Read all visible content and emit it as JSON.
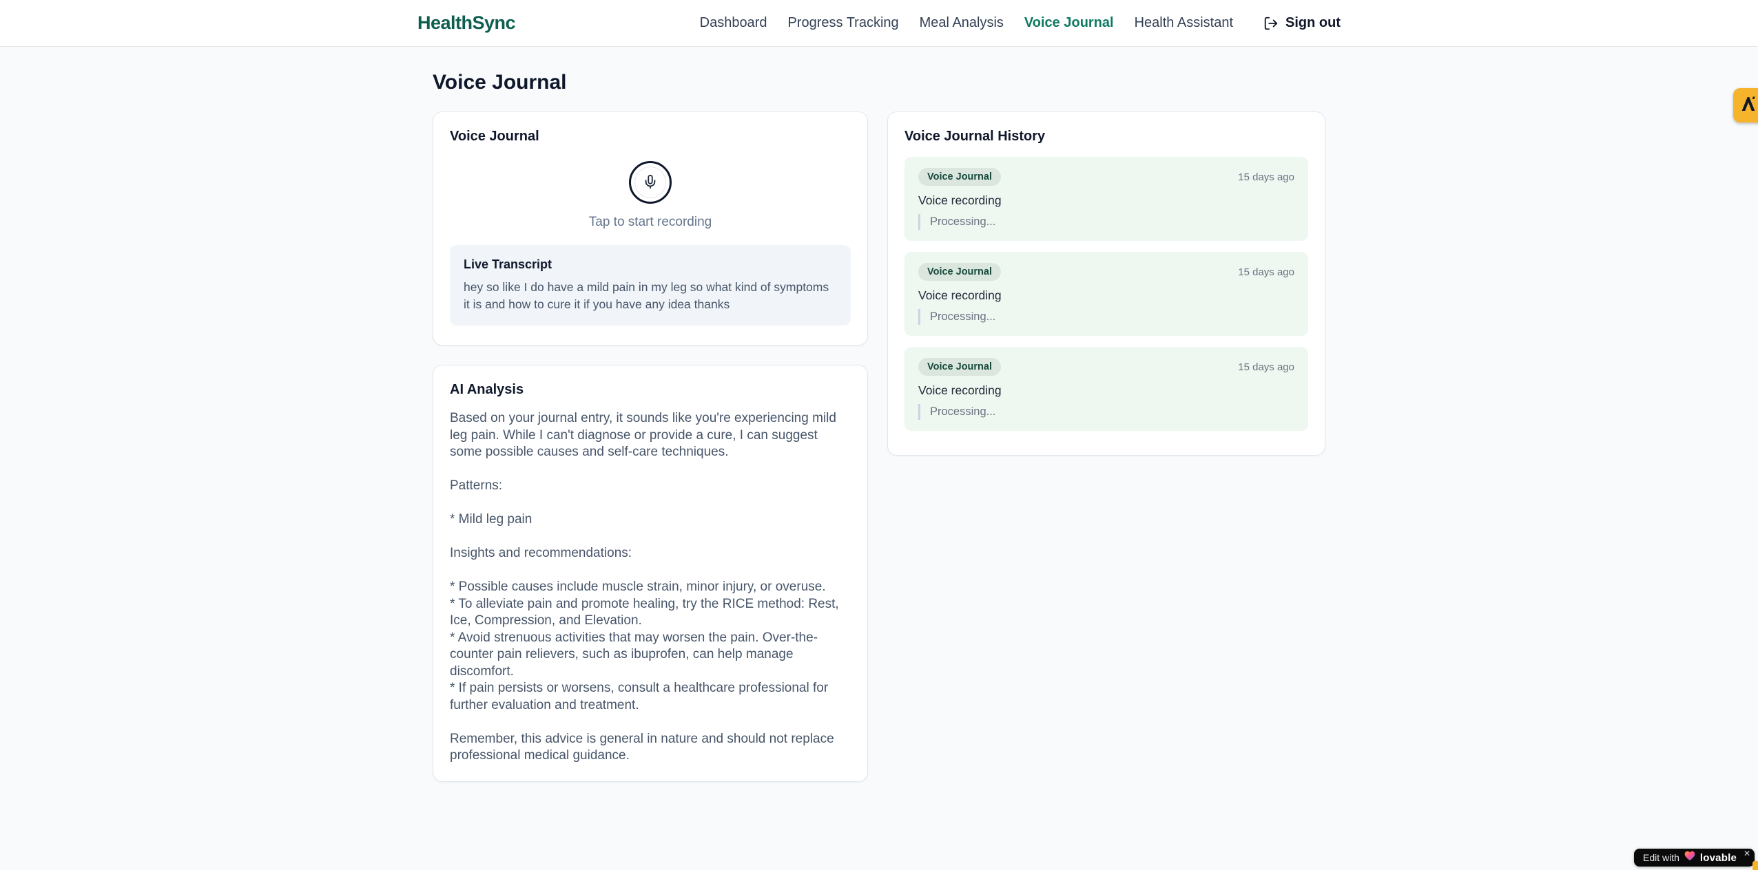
{
  "header": {
    "logo": "HealthSync",
    "nav": [
      {
        "label": "Dashboard"
      },
      {
        "label": "Progress Tracking"
      },
      {
        "label": "Meal Analysis"
      },
      {
        "label": "Voice Journal"
      },
      {
        "label": "Health Assistant"
      }
    ],
    "signout_label": "Sign out"
  },
  "page": {
    "title": "Voice Journal"
  },
  "recorder_card": {
    "title": "Voice Journal",
    "tap_hint": "Tap to start recording",
    "transcript_title": "Live Transcript",
    "transcript_text": "hey so like I do have a mild pain in my leg so what kind of symptoms it is and how to cure it if you have any idea thanks"
  },
  "analysis_card": {
    "title": "AI Analysis",
    "body": "Based on your journal entry, it sounds like you're experiencing mild leg pain. While I can't diagnose or provide a cure, I can suggest some possible causes and self-care techniques.\n\nPatterns:\n\n* Mild leg pain\n\nInsights and recommendations:\n\n* Possible causes include muscle strain, minor injury, or overuse.\n* To alleviate pain and promote healing, try the RICE method: Rest, Ice, Compression, and Elevation.\n* Avoid strenuous activities that may worsen the pain. Over-the-counter pain relievers, such as ibuprofen, can help manage discomfort.\n* If pain persists or worsens, consult a healthcare professional for further evaluation and treatment.\n\nRemember, this advice is general in nature and should not replace professional medical guidance."
  },
  "history_card": {
    "title": "Voice Journal History",
    "entries": [
      {
        "badge": "Voice Journal",
        "time": "15 days ago",
        "summary": "Voice recording",
        "status": "Processing..."
      },
      {
        "badge": "Voice Journal",
        "time": "15 days ago",
        "summary": "Voice recording",
        "status": "Processing..."
      },
      {
        "badge": "Voice Journal",
        "time": "15 days ago",
        "summary": "Voice recording",
        "status": "Processing..."
      }
    ]
  },
  "floating": {
    "lovable_prefix": "Edit with",
    "lovable_name": "lovable",
    "close_glyph": "✕"
  },
  "icons": {
    "mic": "mic-icon",
    "signout": "log-out-icon",
    "heart": "lovable-heart-icon",
    "ext": "lambda-logo-icon"
  },
  "colors": {
    "brand_teal": "#0e5e50",
    "nav_active": "#0d7a63",
    "page_bg": "#f8fafc",
    "card_border": "#e2e8f0",
    "history_entry_bg": "#eff7f1",
    "badge_bg": "#dbe7de",
    "badge_text": "#17493c",
    "muted_text": "#64748b",
    "body_text": "#475569",
    "amber_tab": "#f6b42c",
    "lovable_bg": "#0a0a0a"
  }
}
